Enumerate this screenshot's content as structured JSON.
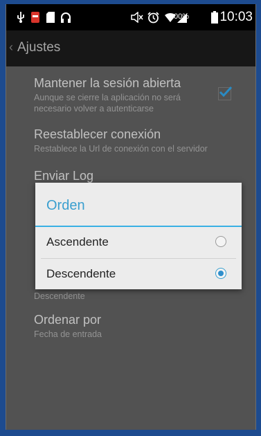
{
  "status_bar": {
    "battery_percent": "100%",
    "time": "10:03"
  },
  "action_bar": {
    "title": "Ajustes"
  },
  "settings": {
    "items": [
      {
        "title": "Mantener la sesión abierta",
        "summary_line1": "Aunque se cierre la aplicación no será",
        "summary_line2": "necesario volver a autenticarse",
        "checked": true
      },
      {
        "title": "Reestablecer conexión",
        "summary_line1": "Restablece la Url de conexión con el servidor"
      },
      {
        "title": "Enviar Log"
      },
      {
        "summary_line1": "Descendente"
      },
      {
        "title": "Ordenar por",
        "summary_line1": "Fecha de entrada"
      }
    ]
  },
  "dialog": {
    "title": "Orden",
    "options": [
      {
        "label": "Ascendente",
        "selected": false
      },
      {
        "label": "Descendente",
        "selected": true
      }
    ]
  },
  "colors": {
    "accent": "#39b0e4",
    "screen_background": "#5e5e5e",
    "dialog_background": "#ececec",
    "outer_background": "#1d4b8f"
  }
}
